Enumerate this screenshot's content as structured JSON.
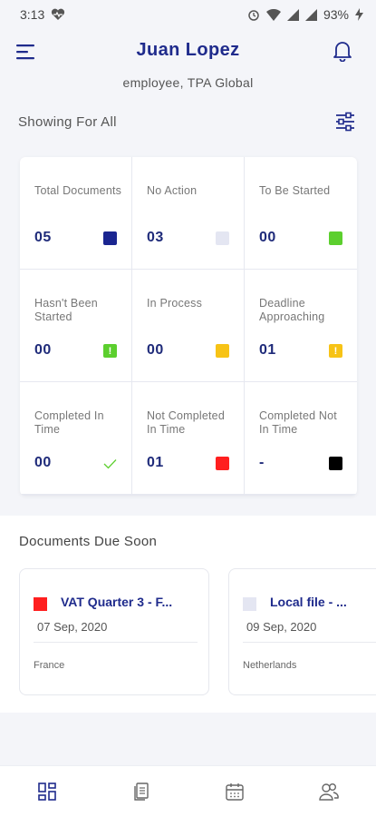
{
  "status_bar": {
    "time": "3:13",
    "battery": "93%"
  },
  "header": {
    "user_name": "Juan Lopez",
    "user_role": "employee, TPA Global"
  },
  "filter": {
    "label": "Showing For All"
  },
  "stats": [
    {
      "label": "Total Documents",
      "value": "05",
      "color": "#1a2590",
      "marker": "square"
    },
    {
      "label": "No Action",
      "value": "03",
      "color": "#e4e6f2",
      "marker": "square"
    },
    {
      "label": "To Be Started",
      "value": "00",
      "color": "#5ccf2e",
      "marker": "square"
    },
    {
      "label": "Hasn't Been Started",
      "value": "00",
      "color": "#5ccf2e",
      "marker": "exclamation"
    },
    {
      "label": "In Process",
      "value": "00",
      "color": "#f7c316",
      "marker": "square"
    },
    {
      "label": "Deadline Approaching",
      "value": "01",
      "color": "#f7c316",
      "marker": "exclamation"
    },
    {
      "label": "Completed In Time",
      "value": "00",
      "color": "#5ccf2e",
      "marker": "check"
    },
    {
      "label": "Not Completed In Time",
      "value": "01",
      "color": "#ff1f1f",
      "marker": "square"
    },
    {
      "label": "Completed Not In Time",
      "value": "-",
      "color": "#000000",
      "marker": "square"
    }
  ],
  "due_soon": {
    "title": "Documents Due Soon",
    "documents": [
      {
        "name": "VAT Quarter 3 - F...",
        "date": "07 Sep, 2020",
        "country": "France",
        "color": "#ff1f1f"
      },
      {
        "name": "Local file - ...",
        "date": "09 Sep, 2020",
        "country": "Netherlands",
        "color": "#e4e6f2"
      }
    ]
  },
  "bottom_nav": {
    "items": [
      "dashboard-icon",
      "documents-icon",
      "calendar-icon",
      "users-icon"
    ]
  },
  "colors": {
    "brand": "#1f2b8c",
    "background": "#f4f5f9"
  }
}
